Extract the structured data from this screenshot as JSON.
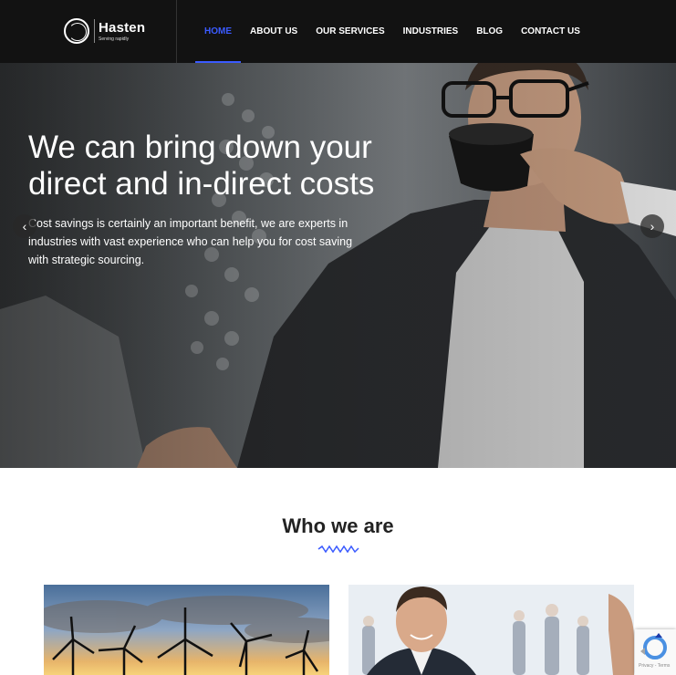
{
  "brand": {
    "name": "Hasten",
    "tagline": "Serving rapidly"
  },
  "nav": {
    "items": [
      {
        "label": "HOME",
        "active": true
      },
      {
        "label": "ABOUT US",
        "active": false
      },
      {
        "label": "OUR SERVICES",
        "active": false
      },
      {
        "label": "INDUSTRIES",
        "active": false
      },
      {
        "label": "BLOG",
        "active": false
      },
      {
        "label": "CONTACT US",
        "active": false
      }
    ]
  },
  "hero": {
    "title": "We can bring down your direct and in-direct costs",
    "subtitle": "Cost savings is certainly an important benefit, we are experts in industries with vast experience who can help you for cost saving with strategic sourcing.",
    "prev_icon": "chevron-left-icon",
    "next_icon": "chevron-right-icon"
  },
  "about": {
    "title": "Who we are"
  },
  "recaptcha": {
    "text": "Privacy - Terms"
  },
  "colors": {
    "header_bg": "#121212",
    "accent": "#3b5bff",
    "text_dark": "#222222"
  }
}
